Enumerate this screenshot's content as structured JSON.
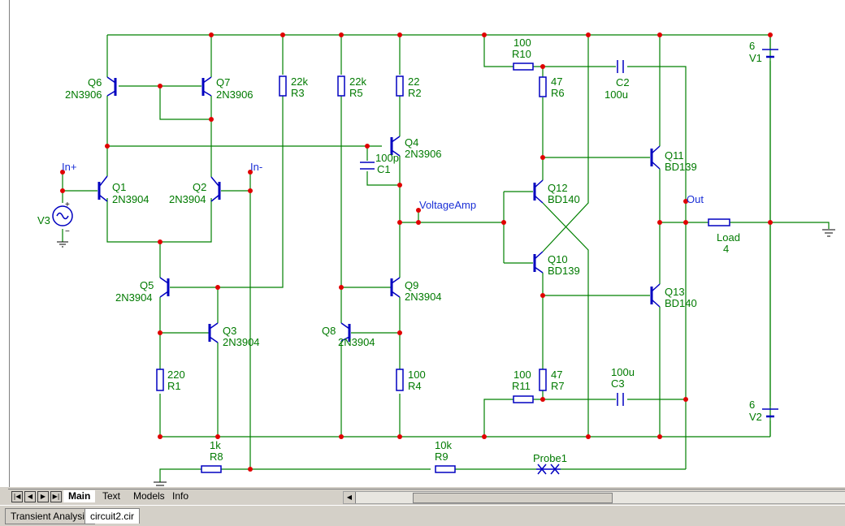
{
  "schematic": {
    "components": {
      "q6": {
        "name": "Q6",
        "model": "2N3906"
      },
      "q7": {
        "name": "Q7",
        "model": "2N3906"
      },
      "q1": {
        "name": "Q1",
        "model": "2N3904"
      },
      "q2": {
        "name": "Q2",
        "model": "2N3904"
      },
      "q5": {
        "name": "Q5",
        "model": "2N3904"
      },
      "q3": {
        "name": "Q3",
        "model": "2N3904"
      },
      "q4": {
        "name": "Q4",
        "model": "2N3906"
      },
      "q9": {
        "name": "Q9",
        "model": "2N3904"
      },
      "q8": {
        "name": "Q8",
        "model": "2N3904"
      },
      "q12": {
        "name": "Q12",
        "model": "BD140"
      },
      "q10": {
        "name": "Q10",
        "model": "BD139"
      },
      "q11": {
        "name": "Q11",
        "model": "BD139"
      },
      "q13": {
        "name": "Q13",
        "model": "BD140"
      },
      "r3": {
        "name": "R3",
        "value": "22k"
      },
      "r5": {
        "name": "R5",
        "value": "22k"
      },
      "r2": {
        "name": "R2",
        "value": "22"
      },
      "r10": {
        "name": "R10",
        "value": "100"
      },
      "r6": {
        "name": "R6",
        "value": "47"
      },
      "r1": {
        "name": "R1",
        "value": "220"
      },
      "r4": {
        "name": "R4",
        "value": "100"
      },
      "r11": {
        "name": "R11",
        "value": "100"
      },
      "r7": {
        "name": "R7",
        "value": "47"
      },
      "r8": {
        "name": "R8",
        "value": "1k"
      },
      "r9": {
        "name": "R9",
        "value": "10k"
      },
      "c1": {
        "name": "C1",
        "value": "100p"
      },
      "c2": {
        "name": "C2",
        "value": "100u"
      },
      "c3": {
        "name": "C3",
        "value": "100u"
      },
      "v1": {
        "name": "V1",
        "value": "6"
      },
      "v2": {
        "name": "V2",
        "value": "6"
      },
      "v3": {
        "name": "V3"
      },
      "load": {
        "name": "Load",
        "value": "4"
      },
      "probe": {
        "name": "Probe1"
      }
    },
    "nets": {
      "in_plus": "In+",
      "in_minus": "In-",
      "voltage_amp": "VoltageAmp",
      "out": "Out"
    },
    "colors": {
      "wire": "#008000",
      "component": "#0000c0",
      "node": "#e00000",
      "label": "#007a00",
      "net_label": "#1a2fd6"
    }
  },
  "sheet_tabs": [
    "Main",
    "Text",
    "Models",
    "Info"
  ],
  "active_sheet_tab": "Main",
  "bottom_tabs": [
    "Transient Analysis",
    "circuit2.cir"
  ],
  "active_bottom_tab": "circuit2.cir"
}
